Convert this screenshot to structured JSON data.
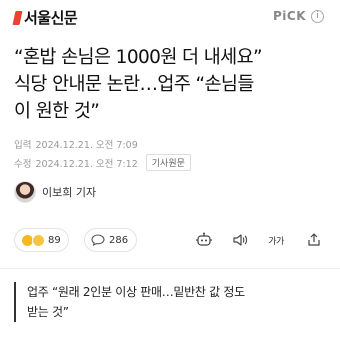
{
  "header": {
    "logo_text": "서울신문",
    "pick_label": "PiCK",
    "info_glyph": "i"
  },
  "article": {
    "title_lines": [
      "“혼밥 손님은 1000원 더 내세요”",
      "식당 안내문 논란…업주 “손님들",
      "이 원한 것”"
    ],
    "published_label": "입력",
    "published_at": "2024.12.21. 오전 7:09",
    "modified_label": "수정",
    "modified_at": "2024.12.21. 오전 7:12",
    "original_button": "기사원문",
    "reporter": "이보희 기자",
    "subheading_lines": [
      "업주 “원래 2인분 이상 판매…밑반찬 값 정도",
      "받는 것”"
    ]
  },
  "actions": {
    "reaction_count": "89",
    "comment_count": "286",
    "font_size_label": "가가"
  },
  "icons": {
    "reaction": "reaction-emoji-icon",
    "comment": "comment-bubble-icon",
    "summary": "ai-summary-robot-icon",
    "audio": "speaker-icon",
    "font_size": "font-size-icon",
    "share": "share-icon"
  },
  "colors": {
    "brand_accent": "#e8442e",
    "meta_text": "#999999",
    "border": "#e3e3e3"
  }
}
